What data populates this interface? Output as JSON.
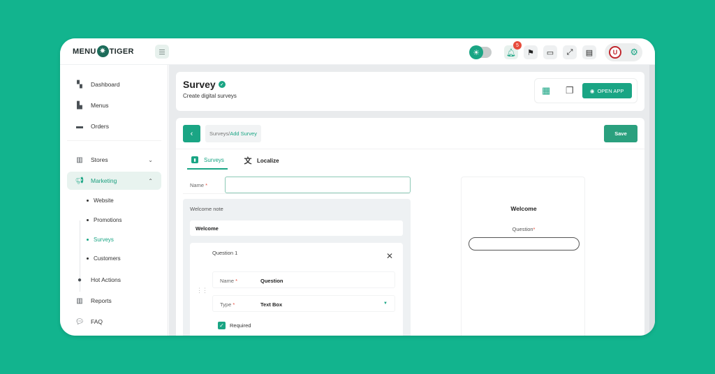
{
  "app": {
    "logo_left": "MENU",
    "logo_right": "TIGER",
    "brand_color": "#1aa584",
    "background_color": "#12b48e"
  },
  "topbar": {
    "notification_count": "5",
    "icons": [
      "theme-toggle-icon",
      "bell-icon",
      "flag-icon",
      "devices-icon",
      "fullscreen-icon",
      "notes-icon",
      "avatar",
      "gear-icon"
    ],
    "avatar_initial": "U"
  },
  "sidebar": {
    "items": [
      {
        "label": "Dashboard",
        "icon": "dashboard-icon"
      },
      {
        "label": "Menus",
        "icon": "menus-icon"
      },
      {
        "label": "Orders",
        "icon": "orders-icon"
      },
      {
        "label": "Stores",
        "icon": "stores-icon"
      },
      {
        "label": "Marketing",
        "icon": "megaphone-icon",
        "active": true
      },
      {
        "label": "Hot Actions",
        "icon": "fire-icon"
      },
      {
        "label": "Reports",
        "icon": "reports-icon"
      },
      {
        "label": "FAQ",
        "icon": "faq-icon"
      }
    ],
    "marketing_sub": [
      {
        "label": "Website"
      },
      {
        "label": "Promotions"
      },
      {
        "label": "Surveys",
        "active": true
      },
      {
        "label": "Customers"
      }
    ]
  },
  "header": {
    "title": "Survey",
    "subtitle": "Create digital surveys",
    "open_app_label": "OPEN APP"
  },
  "content": {
    "breadcrumb_parent": "Surveys/",
    "breadcrumb_current": "Add Survey",
    "save_label": "Save",
    "tabs": [
      {
        "label": "Surveys",
        "active": true
      },
      {
        "label": "Localize"
      }
    ],
    "form": {
      "name_label": "Name",
      "name_value": "",
      "required_mark": "*",
      "welcome_note_label": "Welcome note",
      "welcome_note_value": "Welcome",
      "question": {
        "title": "Question 1",
        "name_label": "Name",
        "name_value": "Question",
        "type_label": "Type",
        "type_value": "Text Box",
        "required_label": "Required",
        "required_checked": true
      }
    },
    "preview": {
      "heading": "Welcome",
      "question_label": "Question",
      "required_mark": "*"
    }
  }
}
